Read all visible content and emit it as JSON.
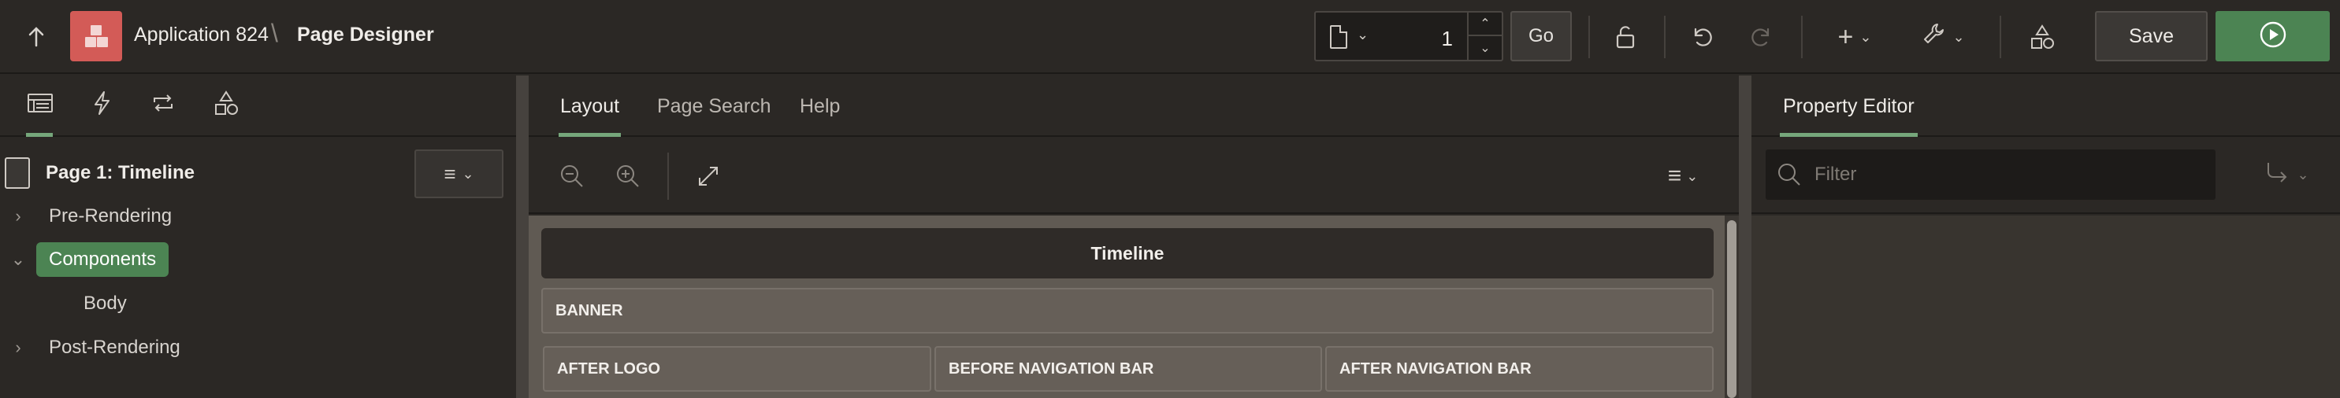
{
  "header": {
    "app_title": "Application 824",
    "separator": "\\",
    "page_title": "Page Designer",
    "page_number": "1",
    "go_label": "Go",
    "save_label": "Save"
  },
  "left": {
    "tabs": [
      "rendering-tab",
      "dynamic-actions-tab",
      "processing-tab",
      "shared-components-tab"
    ],
    "page_label": "Page 1: Timeline",
    "tree": [
      {
        "label": "Pre-Rendering",
        "expanded": false
      },
      {
        "label": "Components",
        "expanded": true,
        "selected": true
      },
      {
        "label": "Body",
        "child": true
      },
      {
        "label": "Post-Rendering",
        "expanded": false
      }
    ]
  },
  "center": {
    "tabs": [
      "Layout",
      "Page Search",
      "Help"
    ],
    "active_tab": "Layout",
    "region_title": "Timeline",
    "slots": {
      "banner": "BANNER",
      "after_logo": "AFTER LOGO",
      "before_nav": "BEFORE NAVIGATION BAR",
      "after_nav": "AFTER NAVIGATION BAR"
    }
  },
  "right": {
    "tab": "Property Editor",
    "filter_placeholder": "Filter"
  },
  "colors": {
    "accent": "#4c8453",
    "app_icon": "#d35b57",
    "background": "#2b2825",
    "canvas": "#605a53"
  }
}
